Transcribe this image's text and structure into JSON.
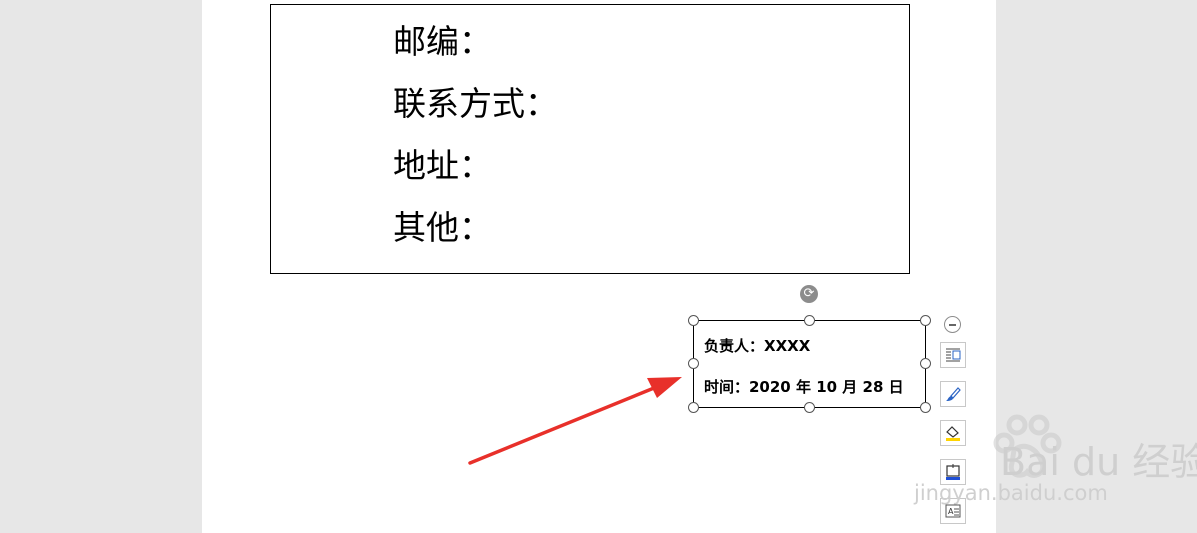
{
  "document": {
    "info_box_lines": [
      "邮编：",
      "联系方式：",
      "地址：",
      "其他："
    ],
    "text_box": {
      "line1": "负责人：XXXX",
      "line2": "时间：2020 年 10 月 28 日"
    }
  },
  "layout_tools": {
    "collapse_icon": "minus-circle-icon",
    "tools": [
      "wrap-text-icon",
      "brush-icon",
      "fill-color-icon",
      "border-color-icon",
      "text-effect-icon"
    ]
  },
  "watermark": {
    "brand": "Bai du 经验",
    "url": "jingyan.baidu.com"
  },
  "colors": {
    "arrow": "#e8302a",
    "page": "#ffffff",
    "background": "#e7e7e7"
  }
}
